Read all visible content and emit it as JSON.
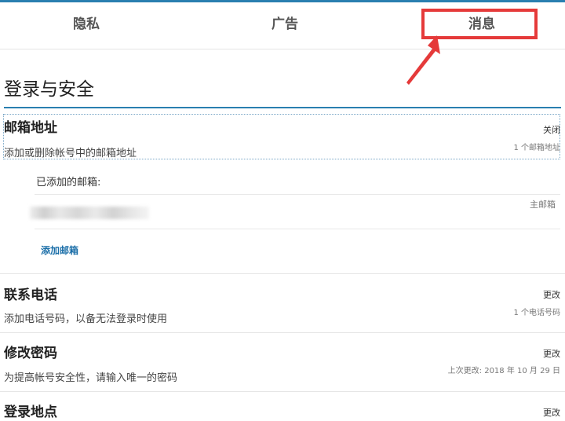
{
  "tabs": [
    {
      "label": "隐私"
    },
    {
      "label": "广告"
    },
    {
      "label": "消息"
    }
  ],
  "colors": {
    "accent": "#2a7fb0",
    "annotation": "#e53a3a",
    "link": "#1a6ea8"
  },
  "section": {
    "title": "登录与安全"
  },
  "email": {
    "title": "邮箱地址",
    "description": "添加或删除帐号中的邮箱地址",
    "action": "关闭",
    "meta": "1 个邮箱地址",
    "added_label": "已添加的邮箱:",
    "primary_label": "主邮箱",
    "add_link": "添加邮箱"
  },
  "phone": {
    "title": "联系电话",
    "description": "添加电话号码，以备无法登录时使用",
    "action": "更改",
    "meta": "1 个电话号码"
  },
  "password": {
    "title": "修改密码",
    "description": "为提高帐号安全性，请输入唯一的密码",
    "action": "更改",
    "meta": "上次更改: 2018 年 10 月 29 日"
  },
  "location": {
    "title": "登录地点",
    "action": "更改"
  }
}
